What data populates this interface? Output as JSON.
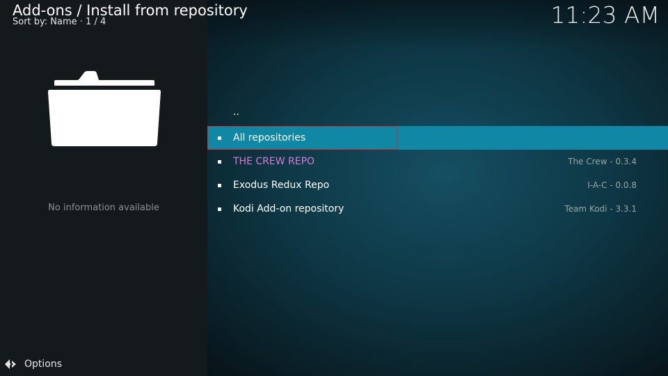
{
  "header": {
    "title": "Add-ons / Install from repository",
    "subtitle": "Sort by: Name  ·  1 / 4",
    "clock": "11:23 AM"
  },
  "info_panel": {
    "icon": "folder-icon",
    "message": "No information available"
  },
  "list": {
    "parent_item": "..",
    "items": [
      {
        "label": "All repositories",
        "meta": "",
        "focused": true
      },
      {
        "label": "THE CREW REPO",
        "meta": "The Crew - 0.3.4",
        "color": "#d77ad8"
      },
      {
        "label": "Exodus Redux Repo",
        "meta": "I-A-C - 0.0.8"
      },
      {
        "label": "Kodi Add-on repository",
        "meta": "Team Kodi - 3.3.1"
      }
    ]
  },
  "footer": {
    "options_label": "Options",
    "options_icon": "options-arrows-icon"
  },
  "colors": {
    "focus_background": "#0f87a5",
    "focus_outline": "#d03030",
    "left_panel": "#14191c"
  }
}
